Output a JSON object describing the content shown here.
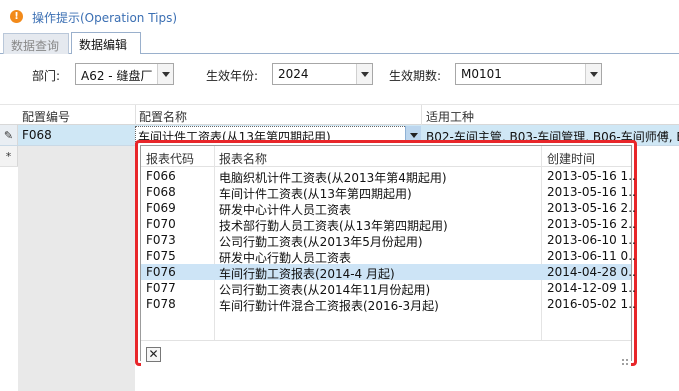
{
  "tips": {
    "text": "操作提示(Operation Tips)",
    "icon": "warning-icon",
    "icon_glyph": "!"
  },
  "tabs": [
    {
      "label": "数据查询",
      "active": false
    },
    {
      "label": "数据编辑",
      "active": true
    }
  ],
  "filters": {
    "dept_label": "部门:",
    "dept_value": "A62 - 缝盘厂",
    "year_label": "生效年份:",
    "year_value": "2024",
    "period_label": "生效期数:",
    "period_value": "M0101"
  },
  "grid": {
    "columns": [
      "配置编号",
      "配置名称",
      "适用工种"
    ],
    "row1": {
      "indicator": "✎",
      "code": "F068",
      "name": "车间计件工资表(从13年第四期起用)",
      "jobs": "B02-车间主管, B03-车间管理, B06-车间师傅, B0"
    },
    "row2": {
      "indicator": "*"
    }
  },
  "popup": {
    "columns": [
      "报表代码",
      "报表名称",
      "创建时间"
    ],
    "rows": [
      {
        "code": "F066",
        "name": "电脑织机计件工资表(从2013年第4期起用)",
        "created": "2013-05-16 1..."
      },
      {
        "code": "F068",
        "name": "车间计件工资表(从13年第四期起用)",
        "created": "2013-05-16 1..."
      },
      {
        "code": "F069",
        "name": "研发中心计件人员工资表",
        "created": "2013-05-16 2..."
      },
      {
        "code": "F070",
        "name": "技术部行勤人员工资表(从13年第四期起用)",
        "created": "2013-05-16 2..."
      },
      {
        "code": "F073",
        "name": "公司行勤工资表(从2013年5月份起用)",
        "created": "2013-06-10 1..."
      },
      {
        "code": "F075",
        "name": "研发中心行勤人员工资表",
        "created": "2013-06-11 0..."
      },
      {
        "code": "F076",
        "name": "车间行勤工资报表(2014-4 月起)",
        "created": "2014-04-28 0...",
        "selected": true
      },
      {
        "code": "F077",
        "name": "公司行勤工资表(从2014年11月份起用)",
        "created": "2014-12-09 1..."
      },
      {
        "code": "F078",
        "name": "车间行勤计件混合工资报表(2016-3月起)",
        "created": "2016-05-02 1..."
      }
    ],
    "close_glyph": "✕"
  },
  "colors": {
    "accent": "#3b6fb3",
    "warning": "#f28a1a",
    "highlight_border": "#e8262a",
    "selected_row": "#cfe7f5"
  }
}
